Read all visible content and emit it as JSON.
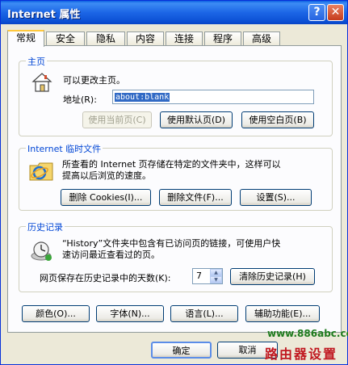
{
  "window": {
    "title": "Internet 属性",
    "help_glyph": "?",
    "close_glyph": "✕"
  },
  "tabs": [
    {
      "label": "常规",
      "active": true
    },
    {
      "label": "安全",
      "active": false
    },
    {
      "label": "隐私",
      "active": false
    },
    {
      "label": "内容",
      "active": false
    },
    {
      "label": "连接",
      "active": false
    },
    {
      "label": "程序",
      "active": false
    },
    {
      "label": "高级",
      "active": false
    }
  ],
  "homepage": {
    "title": "主页",
    "description": "可以更改主页。",
    "address_label": "地址(R):",
    "address_value": "about:blank",
    "use_current_label": "使用当前页(C)",
    "use_default_label": "使用默认页(D)",
    "use_blank_label": "使用空白页(B)"
  },
  "temp_files": {
    "title": "Internet 临时文件",
    "description_line1": "所查看的 Internet 页存储在特定的文件夹中，这样可以",
    "description_line2": "提高以后浏览的速度。",
    "delete_cookies_label": "删除 Cookies(I)...",
    "delete_files_label": "删除文件(F)...",
    "settings_label": "设置(S)..."
  },
  "history": {
    "title": "历史记录",
    "description_line1": "“History”文件夹中包含有已访问页的链接，可使用户快",
    "description_line2": "速访问最近查看过的页。",
    "days_label": "网页保存在历史记录中的天数(K):",
    "days_value": "7",
    "clear_label": "清除历史记录(H)"
  },
  "bottom_buttons": {
    "colors_label": "颜色(O)...",
    "fonts_label": "字体(N)...",
    "languages_label": "语言(L)...",
    "accessibility_label": "辅助功能(E)..."
  },
  "dialog_buttons": {
    "ok_label": "确定",
    "cancel_label": "取消"
  },
  "watermark": {
    "url": "www.886abc.com",
    "text": "路由器设置"
  },
  "colors": {
    "group_title": "#0046d5",
    "selection": "#316ac5",
    "watermark_url": "#1e7b1e",
    "watermark_text": "#c0171f"
  }
}
